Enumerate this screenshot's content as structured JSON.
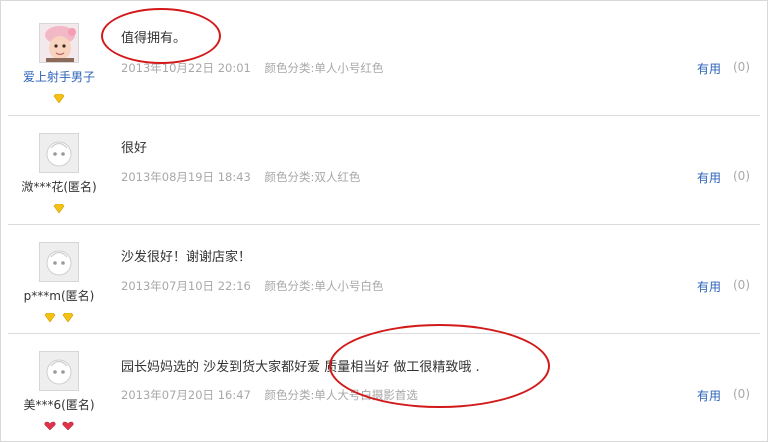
{
  "reviews": [
    {
      "user": "爱上射手男子",
      "avatar_icon": "baby-photo-avatar",
      "badge_icon": "yellow-diamond-icon",
      "badge_count": 1,
      "content": "值得拥有。",
      "date": "2013年10月22日",
      "time": "20:01",
      "sku": "颜色分类:单人小号红色",
      "useful_label": "有用",
      "useful_count": "(0)",
      "highlighted": true
    },
    {
      "user": "溦***花(匿名)",
      "avatar_icon": "default-face-avatar",
      "badge_icon": "yellow-diamond-icon",
      "badge_count": 1,
      "content": "很好",
      "date": "2013年08月19日",
      "time": "18:43",
      "sku": "颜色分类:双人红色",
      "useful_label": "有用",
      "useful_count": "(0)"
    },
    {
      "user": "p***m(匿名)",
      "avatar_icon": "default-face-avatar",
      "badge_icon": "yellow-diamond-icon",
      "badge_count": 2,
      "content": "沙发很好！谢谢店家！",
      "date": "2013年07月10日",
      "time": "22:16",
      "sku": "颜色分类:单人小号白色",
      "useful_label": "有用",
      "useful_count": "(0)"
    },
    {
      "user": "美***6(匿名)",
      "avatar_icon": "default-face-avatar",
      "badge_icon": "red-heart-icon",
      "badge_count": 2,
      "content_a": "园长妈妈选的 沙发到货大家都好",
      "content_b": "爱 质量相当好 做工很精致哦 .",
      "date": "2013年07月20日",
      "time": "16:47",
      "sku": "颜色分类:单人大号白摄影首选",
      "useful_label": "有用",
      "useful_count": "(0)",
      "highlighted": true
    }
  ],
  "colors": {
    "link_blue": "#2c63b8",
    "meta_gray": "#a8a8a8",
    "annotation_red": "#d21a1a",
    "divider": "#dcdcdc"
  }
}
